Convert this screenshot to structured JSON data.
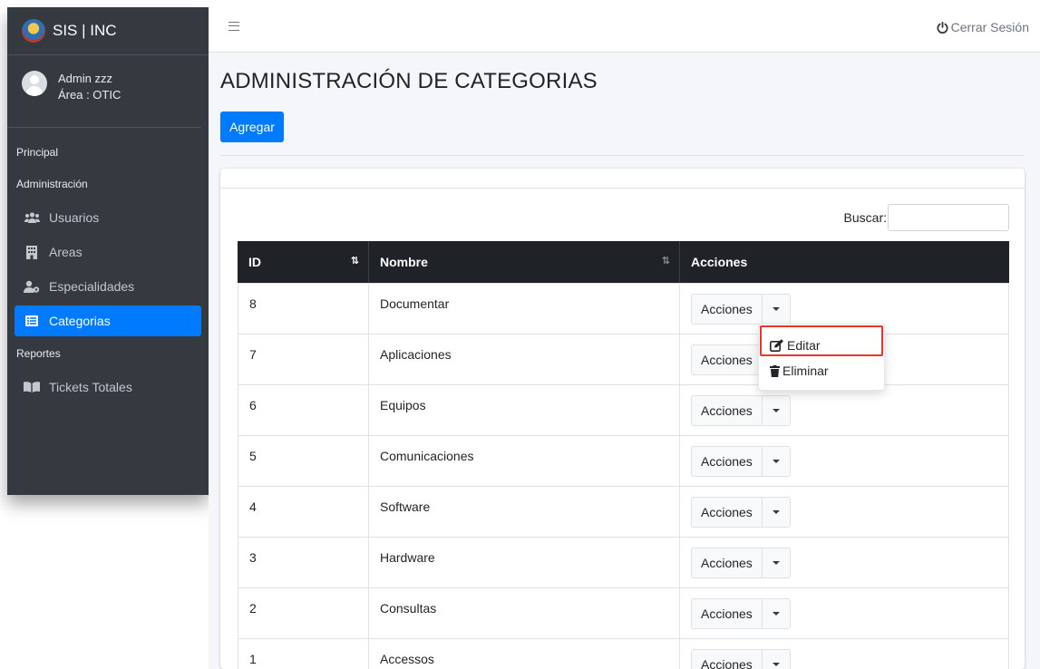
{
  "brand": {
    "title": "SIS | INC"
  },
  "user": {
    "name": "Admin zzz",
    "area": "Área : OTIC"
  },
  "sidebar": {
    "headers": [
      "Principal",
      "Administración",
      "Reportes"
    ],
    "items": [
      {
        "label": "Usuarios",
        "icon": "users-icon"
      },
      {
        "label": "Areas",
        "icon": "building-icon"
      },
      {
        "label": "Especialidades",
        "icon": "user-cog-icon"
      },
      {
        "label": "Categorias",
        "icon": "list-icon",
        "active": true
      },
      {
        "label": "Tickets Totales",
        "icon": "book-icon"
      }
    ]
  },
  "topbar": {
    "logout_label": "Cerrar Sesión"
  },
  "page": {
    "title": "ADMINISTRACIÓN DE CATEGORIAS",
    "add_label": "Agregar",
    "search_label": "Buscar:",
    "search_value": ""
  },
  "table": {
    "headers": [
      "ID",
      "Nombre",
      "Acciones"
    ],
    "rows": [
      {
        "id": "8",
        "nombre": "Documentar"
      },
      {
        "id": "7",
        "nombre": "Aplicaciones"
      },
      {
        "id": "6",
        "nombre": "Equipos"
      },
      {
        "id": "5",
        "nombre": "Comunicaciones"
      },
      {
        "id": "4",
        "nombre": "Software"
      },
      {
        "id": "3",
        "nombre": "Hardware"
      },
      {
        "id": "2",
        "nombre": "Consultas"
      },
      {
        "id": "1",
        "nombre": "Accessos"
      }
    ],
    "action_label": "Acciones"
  },
  "dropdown": {
    "edit_label": "Editar",
    "delete_label": "Eliminar"
  },
  "colors": {
    "primary": "#007bff",
    "sidebar": "#343a40",
    "table_header": "#1f2327",
    "highlight": "#e8362a"
  }
}
